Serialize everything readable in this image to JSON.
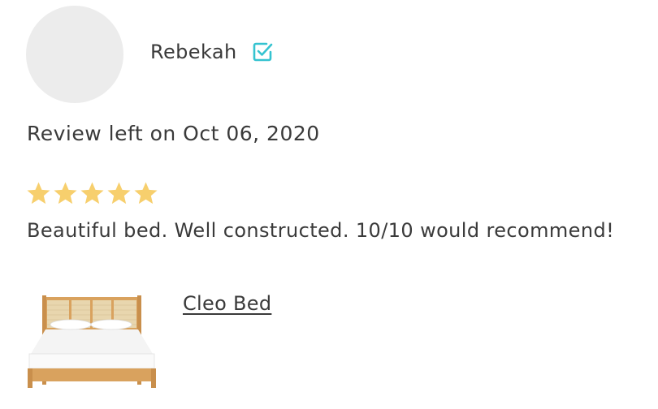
{
  "reviewer": {
    "name": "Rebekah",
    "verified_icon": "verified-check-icon"
  },
  "review": {
    "date_text": "Review left on Oct 06, 2020",
    "rating": 5,
    "rating_max": 5,
    "body": "Beautiful bed. Well constructed. 10/10 would recommend!"
  },
  "product": {
    "name": "Cleo Bed",
    "image_icon": "bed-product-image"
  },
  "colors": {
    "star": "#f7cf6d",
    "verified": "#35c3d0",
    "text": "#3a3a3a",
    "avatar_bg": "#ececec"
  }
}
